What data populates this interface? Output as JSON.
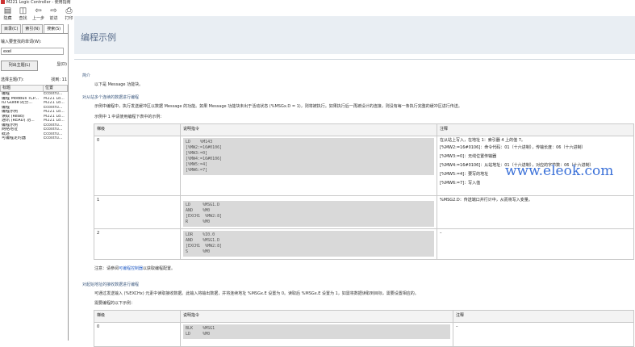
{
  "window": {
    "title": "M221 Logic Controller - 使用指南"
  },
  "toolbar": {
    "buttons": [
      {
        "label": "隐藏",
        "icon": "hide-icon"
      },
      {
        "label": "查找",
        "icon": "locate-icon"
      },
      {
        "label": "上一步",
        "icon": "back-arrow-icon"
      },
      {
        "label": "前进",
        "icon": "forward-arrow-icon"
      },
      {
        "label": "打印",
        "icon": "print-icon"
      }
    ]
  },
  "left": {
    "tabs": [
      "目录(C)",
      "索引(N)",
      "搜索(S)"
    ],
    "search_label": "输入要查找的单词(W):",
    "search_value": "exel",
    "list_button": "列出主题(L)",
    "show_button": "显(D)",
    "select_topic": "选择主题(T):",
    "found_count": "找到: 11",
    "col_title": "标题",
    "col_location": "位置",
    "results": [
      {
        "title": "编程",
        "loc": "Ecostru..."
      },
      {
        "title": "编程 Modbus TCP...",
        "loc": "M221 Lo..."
      },
      {
        "title": "IO Guide 的分...",
        "loc": "M221 Lo..."
      },
      {
        "title": "编程",
        "loc": "Ecostru..."
      },
      {
        "title": "编程示例",
        "loc": "M221 Lo..."
      },
      {
        "title": "读取 (Read)",
        "loc": "M221 Lo..."
      },
      {
        "title": "通讯 (READ) 功...",
        "loc": "M221 Lo..."
      },
      {
        "title": "编程示例",
        "loc": "Ecostru..."
      },
      {
        "title": "网络地址",
        "loc": "Ecostru..."
      },
      {
        "title": "概述",
        "loc": "Ecostru..."
      },
      {
        "title": "可编程定时器",
        "loc": "Ecostru..."
      }
    ]
  },
  "main": {
    "page_title": "编程示例",
    "overview_heading": "简介",
    "overview_text": "以下是 Message 功能块。",
    "section1_heading": "对从站多个连续的数据进行编程",
    "section1_desc": "示例中编程中，执行发送缓冲区以数据 Message 的功能。如果 Message 功能块未出于活动状态 (%MSGx.D = 1)，则将被执行。如果执行后一再被设计的连接，则没有每一条执行完整的缓冲区进行传送。",
    "section1_table_intro": "示例中 1 中请使用编程下表中的示例：",
    "table1": {
      "headers": [
        "梯级",
        "说明指令",
        "注释"
      ],
      "rows": [
        {
          "rung": "0",
          "code": [
            "LD    %M143",
            "[%MW2:=16#0106]",
            "[%MW3:=0]",
            "[%MW4:=16#0106]",
            "[%MW5:=4]",
            "[%MW6:=7]"
          ],
          "comments": [
            "在从站上写入，在地址 1：索引器 4 上的值 7。",
            "[%MW2:=16#0106]：命令代码：01（十六进制），传输长度：06（十六进制）",
            "[%MW3:=0]：无线位置传输器",
            "[%MW4:=16#0106]：从站地址：01（十六进制），对应的字节数：06（十六进制）",
            "[%MW5:=4]：要写的地址",
            "[%MW6:=7]：写入值"
          ]
        },
        {
          "rung": "1",
          "code": [
            "LD     %MSG1.D",
            "AND    %M0",
            "[EXCH1  %MW2:8]",
            "R      %M0"
          ],
          "comments": [
            "%MSG2.D：传送端口并行计中，从而将写入变量。"
          ]
        },
        {
          "rung": "2",
          "code": [
            "LDR    %I0.0",
            "AND    %MSG1.D",
            "[EXCH1  %MW2:8]",
            "S      %M0"
          ],
          "comments": [
            "–"
          ]
        }
      ]
    },
    "note_prefix": "注意：",
    "note_text": "请参阅可编程控制器以获取编程配置。",
    "note_link": "可编程控制器",
    "section2_heading": "对起始地址的接收数据进行编程",
    "section2_desc": "可通过发送输入 (%EXCHx) 元素中读取接收数据。此输入将输出数据，并将连续地址 %MSGx.E 设置为 0。读取后 %MSGx.E 设置为 1，如需将数据读取到目标，需要设置相应的。",
    "section2_table_intro": "需要编程的以下示例：",
    "table2": {
      "headers": [
        "梯级",
        "说明指令",
        "注释"
      ],
      "rows": [
        {
          "rung": "0",
          "code": [
            "BLK    %MSG1",
            "LD     %M0"
          ],
          "comments": [
            "–"
          ]
        }
      ]
    }
  },
  "watermark": "www.eleok.com",
  "colors": {
    "header_band": "#e9eef3",
    "title": "#5a6e8c",
    "link": "#2a62c8",
    "watermark": "#3a70d8"
  }
}
